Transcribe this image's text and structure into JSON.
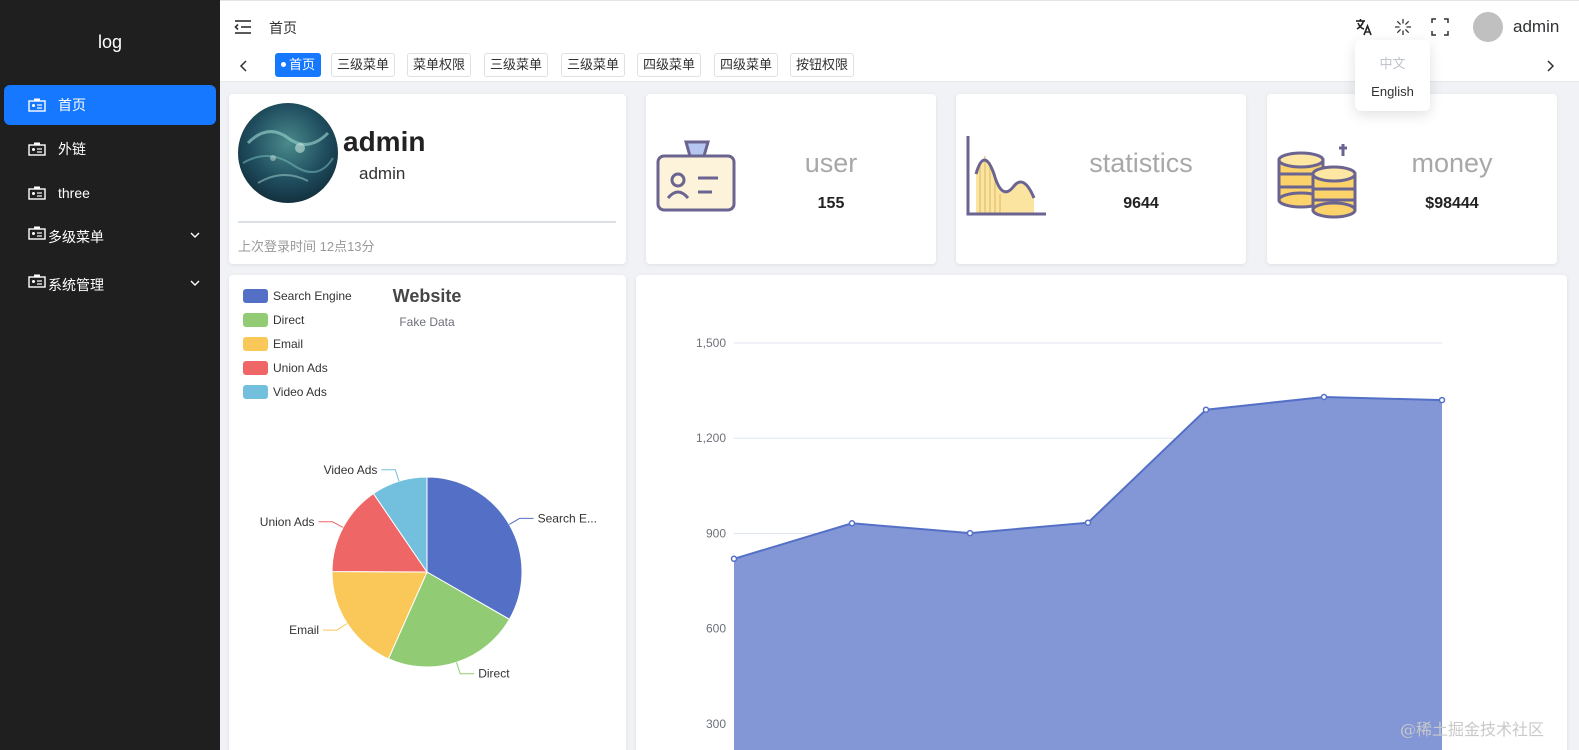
{
  "sidebar": {
    "logo": "log",
    "items": [
      {
        "label": "首页",
        "active": true
      },
      {
        "label": "外链"
      },
      {
        "label": "three"
      },
      {
        "label": "多级菜单",
        "submenu": true
      },
      {
        "label": "系统管理",
        "submenu": true
      }
    ]
  },
  "header": {
    "breadcrumb": "首页",
    "user": "admin",
    "icons": [
      "translate-icon",
      "loading-icon",
      "fullscreen-icon"
    ]
  },
  "language_menu": {
    "options": [
      "中文",
      "English"
    ],
    "disabled": "中文"
  },
  "tabs": [
    "首页",
    "三级菜单",
    "菜单权限",
    "三级菜单",
    "三级菜单",
    "四级菜单",
    "四级菜单",
    "按钮权限"
  ],
  "profile": {
    "name": "admin",
    "role": "admin",
    "last_login": "上次登录时间 12点13分"
  },
  "stats": [
    {
      "title": "user",
      "value": "155"
    },
    {
      "title": "statistics",
      "value": "9644"
    },
    {
      "title": "money",
      "value": "$98444"
    }
  ],
  "colors": {
    "accent": "#1677ff",
    "sidebar_bg": "#1f1f1f",
    "area_fill": "#8396d6",
    "area_line": "#5470c6"
  },
  "chart_data": [
    {
      "type": "pie",
      "title": "Website",
      "subtitle": "Fake Data",
      "legend_position": "top-left",
      "slices": [
        {
          "name": "Search Engine",
          "label": "Search E...",
          "value": 1048,
          "color": "#5470c6"
        },
        {
          "name": "Direct",
          "label": "Direct",
          "value": 735,
          "color": "#91cc75"
        },
        {
          "name": "Email",
          "label": "Email",
          "value": 580,
          "color": "#fac858"
        },
        {
          "name": "Union Ads",
          "label": "Union Ads",
          "value": 484,
          "color": "#ee6666"
        },
        {
          "name": "Video Ads",
          "label": "Video Ads",
          "value": 300,
          "color": "#73c0de"
        }
      ]
    },
    {
      "type": "area",
      "y_ticks": [
        "300",
        "600",
        "900",
        "1,200",
        "1,500"
      ],
      "ylim_visible": [
        180,
        1500
      ],
      "grid": true,
      "values": [
        820,
        932,
        901,
        934,
        1290,
        1330,
        1320
      ]
    }
  ],
  "watermark": "@稀土掘金技术社区"
}
